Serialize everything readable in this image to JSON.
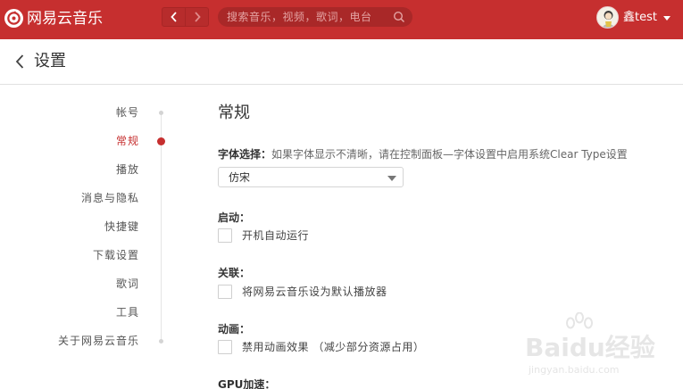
{
  "app": {
    "name": "网易云音乐"
  },
  "header": {
    "search_placeholder": "搜索音乐，视频，歌词，电台",
    "username": "鑫test"
  },
  "page": {
    "title": "设置"
  },
  "sidebar": {
    "active_index": 1,
    "items": [
      {
        "label": "帐号"
      },
      {
        "label": "常规"
      },
      {
        "label": "播放"
      },
      {
        "label": "消息与隐私"
      },
      {
        "label": "快捷键"
      },
      {
        "label": "下载设置"
      },
      {
        "label": "歌词"
      },
      {
        "label": "工具"
      },
      {
        "label": "关于网易云音乐"
      }
    ]
  },
  "general": {
    "title": "常规",
    "font": {
      "label": "字体选择：",
      "hint": "如果字体显示不清晰，请在控制面板—字体设置中启用系统Clear Type设置",
      "selected": "仿宋"
    },
    "startup": {
      "label": "启动：",
      "option": "开机自动运行",
      "checked": false
    },
    "association": {
      "label": "关联：",
      "option": "将网易云音乐设为默认播放器",
      "checked": false
    },
    "animation": {
      "label": "动画：",
      "option": "禁用动画效果 （减少部分资源占用）",
      "checked": false
    },
    "gpu": {
      "label": "GPU加速："
    }
  },
  "watermark": {
    "brand": "Baidu经验",
    "url": "jingyan.baidu.com"
  },
  "colors": {
    "brand": "#c62f2f",
    "text": "#333333",
    "muted": "#666666",
    "border": "#d5d5d5"
  }
}
